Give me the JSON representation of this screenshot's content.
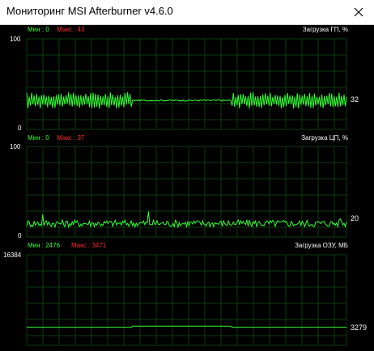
{
  "window": {
    "title": "Мониторинг MSI Afterburner v4.6.0",
    "close_icon": "close-icon"
  },
  "colors": {
    "background": "#000000",
    "grid": "#0b3d0b",
    "line": "#33ff33",
    "min_label": "#33ff33",
    "max_label": "#ff2a2a"
  },
  "graphs": [
    {
      "metric": "Загрузка ГП, %",
      "min_label": "Мин : 0",
      "max_label": "Макс : 43",
      "axis_max": "100",
      "axis_min": "0",
      "current": "32",
      "chart_data": {
        "type": "line",
        "ylim": [
          0,
          100
        ],
        "y_current": 32,
        "segments": [
          {
            "x": [
              0,
              0.33
            ],
            "level": 32,
            "amplitude": 9,
            "noise": "high"
          },
          {
            "x": [
              0.33,
              0.64
            ],
            "level": 32,
            "amplitude": 1.5,
            "noise": "low"
          },
          {
            "x": [
              0.64,
              1.0
            ],
            "level": 32,
            "amplitude": 9,
            "noise": "high"
          }
        ]
      }
    },
    {
      "metric": "Загрузка ЦП, %",
      "min_label": "Мин : 0",
      "max_label": "Макс : 37",
      "axis_max": "100",
      "axis_min": "0",
      "current": "20",
      "chart_data": {
        "type": "line",
        "ylim": [
          0,
          100
        ],
        "y_current": 20,
        "segments": [
          {
            "x": [
              0,
              1.0
            ],
            "level": 15,
            "amplitude": 4,
            "noise": "medium"
          }
        ],
        "spikes": [
          {
            "x": 0.05,
            "y": 25
          },
          {
            "x": 0.38,
            "y": 28
          },
          {
            "x": 0.98,
            "y": 20
          }
        ]
      }
    },
    {
      "metric": "Загрузка ОЗУ, МБ",
      "min_label": "Мин : 2476",
      "max_label": "Макс : 3471",
      "axis_max": "16384",
      "axis_min": "",
      "current": "3279",
      "chart_data": {
        "type": "line",
        "ylim": [
          0,
          16384
        ],
        "y_current": 3279,
        "segments": [
          {
            "x": [
              0,
              0.33
            ],
            "level": 3279,
            "amplitude": 0,
            "noise": "none"
          },
          {
            "x": [
              0.33,
              0.64
            ],
            "level": 3471,
            "amplitude": 0,
            "noise": "none"
          },
          {
            "x": [
              0.64,
              1.0
            ],
            "level": 3279,
            "amplitude": 0,
            "noise": "none"
          }
        ]
      }
    }
  ]
}
